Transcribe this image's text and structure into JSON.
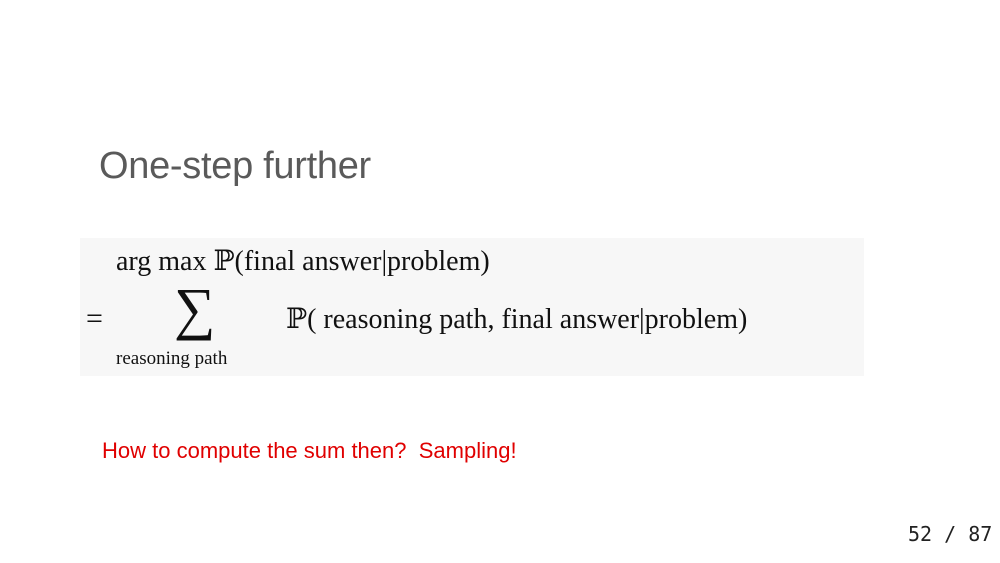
{
  "slide": {
    "title": "One-step further",
    "math": {
      "line1_operator": "arg max",
      "line1_prob": "ℙ",
      "line1_expr": "(final answer|problem)",
      "equals": "=",
      "sum_symbol": "∑",
      "sum_subscript": "reasoning path",
      "line2_prob": "ℙ",
      "line2_expr": "( reasoning path, final answer|problem)"
    },
    "note": "How to compute the sum then?  Sampling!",
    "page_number": "52 / 87"
  }
}
